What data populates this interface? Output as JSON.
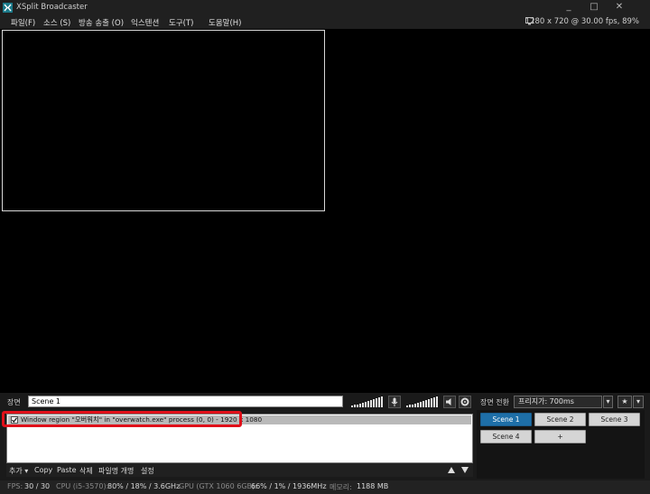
{
  "window": {
    "title": "XSplit Broadcaster"
  },
  "menu": [
    "파일(F)",
    "소스 (S)",
    "방송 송출 (O)",
    "익스텐션",
    "도구(T)",
    "도움말(H)"
  ],
  "resolution_info": "1280 x 720 @ 30.00 fps, 89%",
  "scene": {
    "label": "장면",
    "name": "Scene 1"
  },
  "sources": [
    {
      "checked": true,
      "text": "Window region \"오버워치\" in \"overwatch.exe\" process (0, 0) - 1920 x 1080"
    }
  ],
  "source_toolbar": {
    "add": "추가",
    "copy": "Copy",
    "paste": "Paste",
    "delete": "삭제",
    "rename": "파일명 개명",
    "settings": "설정"
  },
  "transition": {
    "label": "장면 전환",
    "value": "프리지가: 700ms"
  },
  "scene_buttons": [
    "Scene 1",
    "Scene 2",
    "Scene 3",
    "Scene 4",
    "+"
  ],
  "active_scene": "Scene 1",
  "status": {
    "fps_label": "FPS:",
    "fps_value": "30 / 30",
    "cpu_label": "CPU (i5-3570):",
    "cpu_value": "80% / 18% / 3.6GHz",
    "gpu_label": "GPU (GTX 1060 6GB):",
    "gpu_value": "66% / 1% / 1936MHz",
    "mem_label": "메모리:",
    "mem_value": "1188 MB"
  },
  "colors": {
    "accent": "#1e6fa8",
    "highlight": "#e0101a",
    "background": "#000000"
  }
}
